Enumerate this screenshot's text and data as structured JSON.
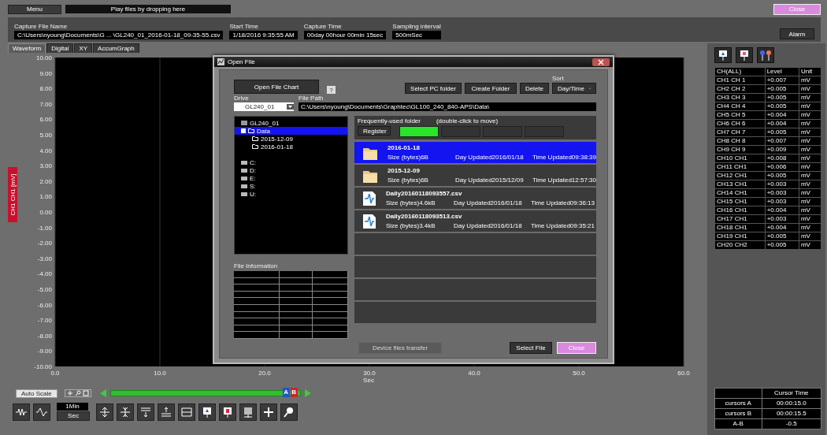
{
  "menu_button": "Menu",
  "drop_hint": "Play files by dropping here",
  "close_button": "Close",
  "info": [
    {
      "label": "Capture File Name",
      "value": "C:\\Users\\nyoung\\Documents\\G ... \\GL240_01_2016-01-18_09-35-55.csv"
    },
    {
      "label": "Start Time",
      "value": "1/18/2016 9:35:55 AM"
    },
    {
      "label": "Capture Time",
      "value": "00day 00hour 00min 15sec"
    },
    {
      "label": "Sampling interval",
      "value": "500mSec"
    }
  ],
  "alarm_button": "Alarm",
  "tabs": [
    {
      "label": "Waveform",
      "selected": true
    },
    {
      "label": "Digital",
      "selected": false
    },
    {
      "label": "XY",
      "selected": false
    },
    {
      "label": "AccumGraph",
      "selected": false
    }
  ],
  "chart": {
    "chart_data": {
      "type": "line",
      "grid": true,
      "xlabel": "Sec",
      "ylabel": "CH1 CH1 [mV]",
      "xlim": [
        0,
        60
      ],
      "ylim": [
        -10,
        10
      ],
      "xticks": [
        {
          "value": 0,
          "label": "0.0"
        },
        {
          "value": 10,
          "label": "10.0"
        },
        {
          "value": 20,
          "label": "20.0"
        },
        {
          "value": 30,
          "label": "30.0"
        },
        {
          "value": 40,
          "label": "40.0"
        },
        {
          "value": 50,
          "label": "50.0"
        },
        {
          "value": 60,
          "label": "60.0"
        }
      ],
      "yticks": [
        {
          "value": 10,
          "label": "10.00"
        },
        {
          "value": 9,
          "label": "9.00"
        },
        {
          "value": 8,
          "label": "8.00"
        },
        {
          "value": 7,
          "label": "7.00"
        },
        {
          "value": 6,
          "label": "6.00"
        },
        {
          "value": 5,
          "label": "5.00"
        },
        {
          "value": 4,
          "label": "4.00"
        },
        {
          "value": 3,
          "label": "3.00"
        },
        {
          "value": 2,
          "label": "2.00"
        },
        {
          "value": 1,
          "label": "1.00"
        },
        {
          "value": 0,
          "label": "0.00"
        },
        {
          "value": -1,
          "label": "-1.00"
        },
        {
          "value": -2,
          "label": "-2.00"
        },
        {
          "value": -3,
          "label": "-3.00"
        },
        {
          "value": -4,
          "label": "-4.00"
        },
        {
          "value": -5,
          "label": "-5.00"
        },
        {
          "value": -6,
          "label": "-6.00"
        },
        {
          "value": -7,
          "label": "-7.00"
        },
        {
          "value": -8,
          "label": "-8.00"
        },
        {
          "value": -9,
          "label": "-9.00"
        },
        {
          "value": -10,
          "label": "-10.00"
        }
      ]
    }
  },
  "auto_scale_button": "Auto Scale",
  "cursor_markers": [
    "A",
    "B"
  ],
  "time_span": {
    "value": "1Min",
    "unit": "Sec"
  },
  "channel_table": {
    "columns": [
      "CH(ALL)",
      "Level",
      "Unit"
    ],
    "rows": [
      {
        "channel": "CH1 CH 1",
        "level": "+0.007",
        "unit": "mV"
      },
      {
        "channel": "CH2 CH 2",
        "level": "+0.005",
        "unit": "mV"
      },
      {
        "channel": "CH3 CH 3",
        "level": "+0.005",
        "unit": "mV"
      },
      {
        "channel": "CH4 CH 4",
        "level": "+0.005",
        "unit": "mV"
      },
      {
        "channel": "CH5 CH 5",
        "level": "+0.004",
        "unit": "mV"
      },
      {
        "channel": "CH6 CH 6",
        "level": "+0.004",
        "unit": "mV"
      },
      {
        "channel": "CH7 CH 7",
        "level": "+0.005",
        "unit": "mV"
      },
      {
        "channel": "CH8 CH 8",
        "level": "+0.007",
        "unit": "mV"
      },
      {
        "channel": "CH9 CH 9",
        "level": "+0.009",
        "unit": "mV"
      },
      {
        "channel": "CH10 CH1",
        "level": "+0.008",
        "unit": "mV"
      },
      {
        "channel": "CH11 CH1",
        "level": "+0.006",
        "unit": "mV"
      },
      {
        "channel": "CH12 CH1",
        "level": "+0.005",
        "unit": "mV"
      },
      {
        "channel": "CH13 CH1",
        "level": "+0.003",
        "unit": "mV"
      },
      {
        "channel": "CH14 CH1",
        "level": "+0.003",
        "unit": "mV"
      },
      {
        "channel": "CH15 CH1",
        "level": "+0.003",
        "unit": "mV"
      },
      {
        "channel": "CH16 CH1",
        "level": "+0.004",
        "unit": "mV"
      },
      {
        "channel": "CH17 CH1",
        "level": "+0.003",
        "unit": "mV"
      },
      {
        "channel": "CH18 CH1",
        "level": "+0.004",
        "unit": "mV"
      },
      {
        "channel": "CH19 CH1",
        "level": "+0.005",
        "unit": "mV"
      },
      {
        "channel": "CH20 CH2",
        "level": "+0.005",
        "unit": "mV"
      }
    ]
  },
  "cursor_table": {
    "header": "Cursor Time",
    "rows": [
      {
        "label": "cursors A",
        "value": "00:00:15.0"
      },
      {
        "label": "cursors B",
        "value": "00:00:15.5"
      },
      {
        "label": "A-B",
        "value": "-0.5"
      }
    ]
  },
  "dialog": {
    "title": "Open File",
    "open_chart_button": "Open File Chart",
    "help_button": "?",
    "select_pc_folder_button": "Select PC folder",
    "create_folder_button": "Create Folder",
    "delete_button": "Delete",
    "sort": {
      "label": "Sort",
      "value": "Day/Time"
    },
    "drive": {
      "label": "Drive",
      "value": "GL240_01"
    },
    "file_path": {
      "label": "File Path",
      "value": "C:\\Users\\nyoung\\Documents\\Graphtec\\GL100_240_840-APS\\Data\\"
    },
    "device": "GL240_01",
    "tree": [
      {
        "label": "Data",
        "selected": true,
        "expanded": true,
        "children": [
          {
            "label": "2015-12-09",
            "selected": false
          },
          {
            "label": "2016-01-18",
            "selected": false
          }
        ]
      }
    ],
    "drives": [
      "C:",
      "D:",
      "E:",
      "S:",
      "U:"
    ],
    "file_info_label": "File Information",
    "frequent": {
      "label": "Frequently-used folder",
      "hint": "(double-click to move)",
      "register_button": "Register",
      "slots": [
        {
          "selected": true
        },
        {
          "selected": false
        },
        {
          "selected": false
        },
        {
          "selected": false
        }
      ]
    },
    "files": [
      {
        "kind": "folder",
        "name": "2016-01-18",
        "size": "Size (bytes)6B",
        "day": "Day Updated2016/01/18",
        "time": "Time Updated09:38:39",
        "selected": true
      },
      {
        "kind": "folder",
        "name": "2015-12-09",
        "size": "Size (bytes)6B",
        "day": "Day Updated2015/12/09",
        "time": "Time Updated12:57:30",
        "selected": false
      },
      {
        "kind": "file",
        "name": "Daily20160118093557.csv",
        "size": "Size (bytes)4.6kB",
        "day": "Day Updated2016/01/18",
        "time": "Time Updated09:36:13",
        "selected": false
      },
      {
        "kind": "file",
        "name": "Daily20160118093513.csv",
        "size": "Size (bytes)3.4kB",
        "day": "Day Updated2016/01/18",
        "time": "Time Updated09:35:21",
        "selected": false
      }
    ],
    "transfer_button": {
      "label": "Device files transfer",
      "disabled": true
    },
    "select_file_button": "Select File",
    "close_button": "Close"
  }
}
